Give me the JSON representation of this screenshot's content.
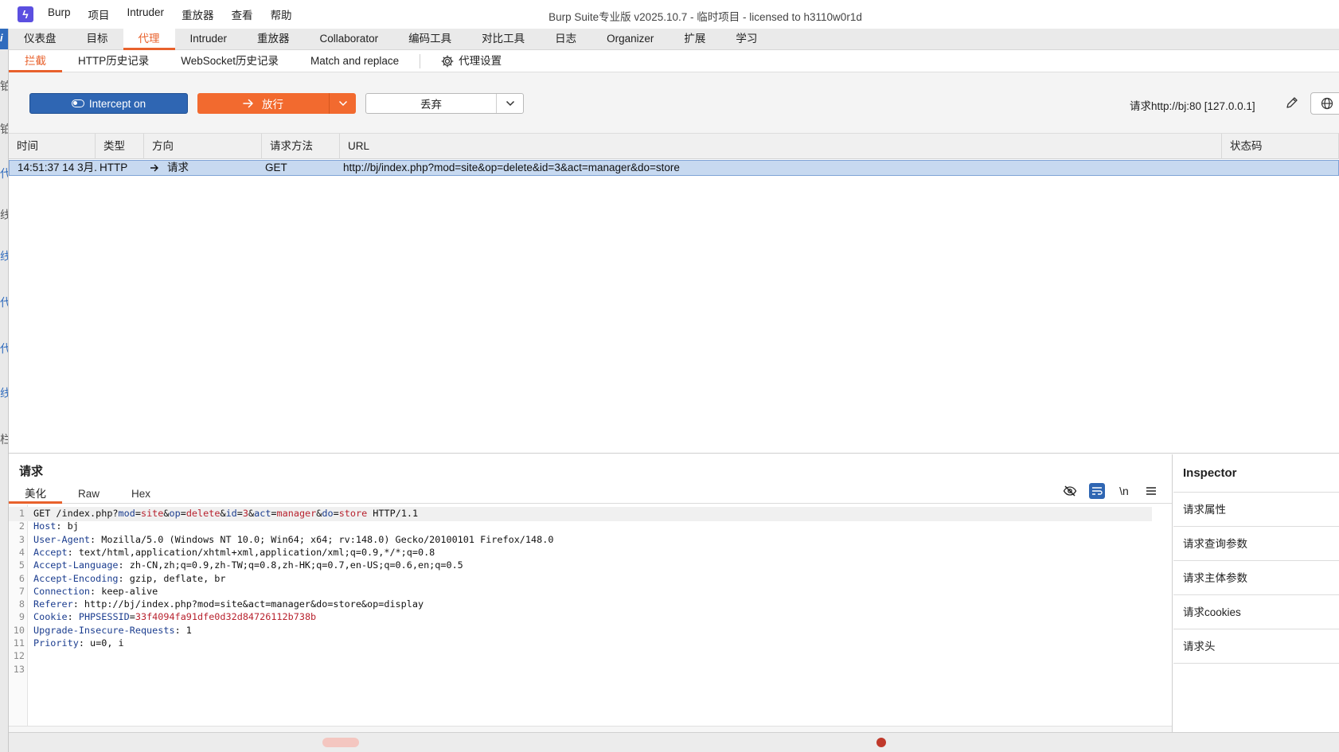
{
  "window": {
    "title": "Burp Suite专业版  v2025.10.7 - 临时项目 - licensed to h3110w0r1d"
  },
  "menu": [
    "Burp",
    "项目",
    "Intruder",
    "重放器",
    "查看",
    "帮助"
  ],
  "main_tabs": [
    "仪表盘",
    "目标",
    "代理",
    "Intruder",
    "重放器",
    "Collaborator",
    "编码工具",
    "对比工具",
    "日志",
    "Organizer",
    "扩展",
    "学习"
  ],
  "sub_tabs": [
    "拦截",
    "HTTP历史记录",
    "WebSocket历史记录",
    "Match and replace",
    "代理设置"
  ],
  "toolbar": {
    "intercept_label": "Intercept on",
    "forward_label": "放行",
    "drop_label": "丢弃",
    "request_info": "请求http://bj:80  [127.0.0.1]"
  },
  "table": {
    "columns": [
      "时间",
      "类型",
      "方向",
      "请求方法",
      "URL",
      "状态码"
    ],
    "rows": [
      {
        "time": "14:51:37 14 3月...",
        "type": "HTTP",
        "direction": "请求",
        "method": "GET",
        "url": "http://bj/index.php?mod=site&op=delete&id=3&act=manager&do=store"
      }
    ]
  },
  "request_panel": {
    "title": "请求",
    "view_tabs": [
      "美化",
      "Raw",
      "Hex"
    ],
    "newline_label": "\\n",
    "lines": [
      "GET /index.php?mod=site&op=delete&id=3&act=manager&do=store HTTP/1.1",
      "Host: bj",
      "User-Agent: Mozilla/5.0 (Windows NT 10.0; Win64; x64; rv:148.0) Gecko/20100101 Firefox/148.0",
      "Accept: text/html,application/xhtml+xml,application/xml;q=0.9,*/*;q=0.8",
      "Accept-Language: zh-CN,zh;q=0.9,zh-TW;q=0.8,zh-HK;q=0.7,en-US;q=0.6,en;q=0.5",
      "Accept-Encoding: gzip, deflate, br",
      "Connection: keep-alive",
      "Referer: http://bj/index.php?mod=site&act=manager&do=store&op=display",
      "Cookie: PHPSESSID=33f4094fa91dfe0d32d84726112b738b",
      "Upgrade-Insecure-Requests: 1",
      "Priority: u=0, i",
      "",
      ""
    ]
  },
  "inspector": {
    "title": "Inspector",
    "items": [
      "请求属性",
      "请求查询参数",
      "请求主体参数",
      "请求cookies",
      "请求头"
    ]
  },
  "colors": {
    "accent": "#e8612c",
    "intercept_blue": "#2f66b3",
    "forward_orange": "#f26a2f",
    "selected_row": "#c7d9f0"
  }
}
